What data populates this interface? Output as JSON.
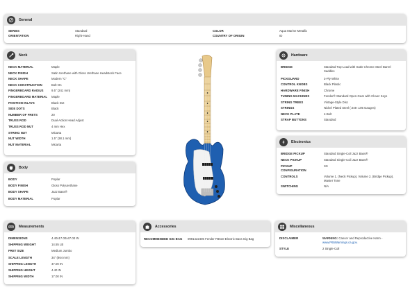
{
  "general": {
    "title": "General",
    "rows": [
      {
        "label": "SERIES",
        "value": "Standard"
      },
      {
        "label": "ORIENTATION",
        "value": "Right-Hand"
      },
      {
        "label": "COLOR",
        "value": "Aqua Marine Metallic"
      },
      {
        "label": "COUNTRY OF ORIGIN",
        "value": "ID"
      }
    ]
  },
  "neck": {
    "title": "Neck",
    "rows": [
      {
        "label": "NECK MATERIAL",
        "value": "Maple"
      },
      {
        "label": "NECK FINISH",
        "value": "Satin Urethane with Gloss Urethane Headstock Face"
      },
      {
        "label": "NECK SHAPE",
        "value": "Modern \"C\""
      },
      {
        "label": "NECK CONSTRUCTION",
        "value": "Bolt-On"
      },
      {
        "label": "FINGERBOARD RADIUS",
        "value": "9.5\" (241 mm)"
      },
      {
        "label": "FINGERBOARD MATERIAL",
        "value": "Maple"
      },
      {
        "label": "POSITION INLAYS",
        "value": "Black Dot"
      },
      {
        "label": "SIDE DOTS",
        "value": "Black"
      },
      {
        "label": "NUMBER OF FRETS",
        "value": "20"
      },
      {
        "label": "TRUSS ROD",
        "value": "Dual-Action Head Adjust"
      },
      {
        "label": "TRUSS ROD NUT",
        "value": "4 mm Hex"
      },
      {
        "label": "STRING NUT",
        "value": "Micarta"
      },
      {
        "label": "NUT WIDTH",
        "value": "1.5\" (38.1 mm)"
      },
      {
        "label": "NUT MATERIAL",
        "value": "Micarta"
      }
    ]
  },
  "body": {
    "title": "Body",
    "rows": [
      {
        "label": "BODY",
        "value": "Poplar"
      },
      {
        "label": "BODY FINISH",
        "value": "Gloss Polyurethane"
      },
      {
        "label": "BODY SHAPE",
        "value": "Jazz Bass®"
      },
      {
        "label": "BODY MATERIAL",
        "value": "Poplar"
      }
    ]
  },
  "hardware": {
    "title": "Hardware",
    "rows": [
      {
        "label": "BRIDGE",
        "value": "Standard Top-Load with Satin Chrome Steel Barrel Saddles"
      },
      {
        "label": "PICKGUARD",
        "value": "3-Ply White"
      },
      {
        "label": "CONTROL KNOBS",
        "value": "Black Plastic"
      },
      {
        "label": "HARDWARE FINISH",
        "value": "Chrome"
      },
      {
        "label": "TUNING MACHINES",
        "value": "Fender® Standard Open-Gear with Clover Keys"
      },
      {
        "label": "STRING TREES",
        "value": "Vintage-Style Disc"
      },
      {
        "label": "STRINGS",
        "value": "Nickel Plated Steel (.045-.105 Gauges)"
      },
      {
        "label": "NECK PLATE",
        "value": "4-Bolt"
      },
      {
        "label": "STRAP BUTTONS",
        "value": "Standard"
      }
    ]
  },
  "electronics": {
    "title": "Electronics",
    "rows": [
      {
        "label": "BRIDGE PICKUP",
        "value": "Standard Single-Coil Jazz Bass®"
      },
      {
        "label": "NECK PICKUP",
        "value": "Standard Single-Coil Jazz Bass®"
      },
      {
        "label": "PICKUP CONFIGURATION",
        "value": "SS"
      },
      {
        "label": "CONTROLS",
        "value": "Volume 1. (Neck Pickup), Volume 2. (Bridge Pickup), Master Tone"
      },
      {
        "label": "SWITCHING",
        "value": "N/A"
      }
    ]
  },
  "measurements": {
    "title": "Measurements",
    "rows": [
      {
        "label": "DIMENSIONS",
        "value": "4.40x17.00x47.00 IN"
      },
      {
        "label": "SHIPPING WEIGHT",
        "value": "14.55 LB"
      },
      {
        "label": "FRET SIZE",
        "value": "Medium Jumbo"
      },
      {
        "label": "SCALE LENGTH",
        "value": "34\" (864 mm)"
      },
      {
        "label": "SHIPPING LENGTH",
        "value": "47.00 IN"
      },
      {
        "label": "SHIPPING HEIGHT",
        "value": "4.40 IN"
      },
      {
        "label": "SHIPPING WIDTH",
        "value": "17.00 IN"
      }
    ]
  },
  "accessories": {
    "title": "Accessories",
    "rows": [
      {
        "label": "RECOMMENDED GIG BAG",
        "value": "0991422406 Fender FB610 Electric Bass Gig Bag"
      }
    ]
  },
  "miscellaneous": {
    "title": "Miscellaneous",
    "disclaimer_label": "DISCLAIMER",
    "disclaimer_warning": "WARNING:",
    "disclaimer_text": " Cancer and Reproductive Harm -",
    "disclaimer_link": "www.P65Warnings.ca.gov.",
    "style_label": "STYLE",
    "style_value": "2 Single-Coil"
  },
  "colors": {
    "header_bg": "#e5e5e5",
    "icon_bg": "#3c3c3c",
    "guitar_body": "#1f5fb0",
    "link": "#1a5fb4"
  },
  "icons": [
    "guitar-icon",
    "neck-icon",
    "body-icon",
    "hardware-icon",
    "electronics-icon",
    "ruler-icon",
    "accessories-icon",
    "misc-icon"
  ]
}
